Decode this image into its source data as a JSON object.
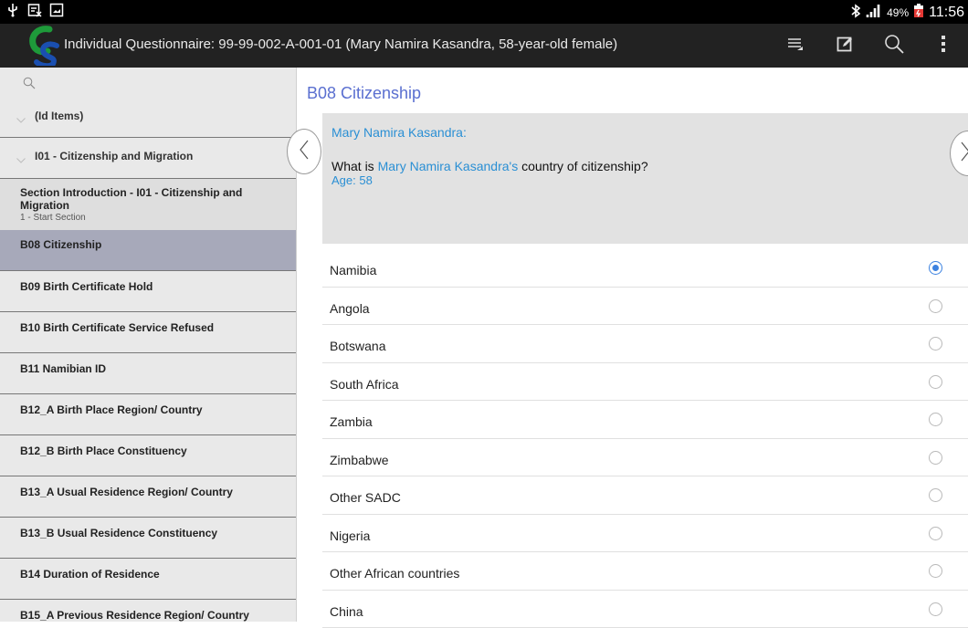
{
  "statusbar": {
    "left_icons": [
      "usb-icon",
      "notification-icon",
      "screenshot-icon"
    ],
    "battery_percent": "49%",
    "time": "11:56"
  },
  "actionbar": {
    "title": "Individual Questionnaire: 99-99-002-A-001-01 (Mary Namira Kasandra, 58-year-old female)",
    "actions": [
      "list-icon",
      "edit-icon",
      "search-icon",
      "overflow-menu-icon"
    ],
    "colors": {
      "background": "#222222",
      "logo_green": "#1e9a3a",
      "logo_blue": "#1a4fb0"
    }
  },
  "sidebar": {
    "items": [
      {
        "label": "(Id Items)",
        "type": "group"
      },
      {
        "label": "I01 - Citizenship and Migration",
        "type": "group"
      },
      {
        "label": "Section Introduction - I01 - Citizenship and Migration",
        "sub": "1 - Start Section",
        "type": "intro"
      },
      {
        "label": "B08 Citizenship",
        "type": "active"
      },
      {
        "label": "B09 Birth Certificate Hold",
        "type": "item"
      },
      {
        "label": "B10 Birth Certificate Service Refused",
        "type": "item"
      },
      {
        "label": "B11 Namibian ID",
        "type": "item"
      },
      {
        "label": "B12_A Birth Place Region/ Country",
        "type": "item"
      },
      {
        "label": "B12_B Birth Place Constituency",
        "type": "item"
      },
      {
        "label": "B13_A Usual Residence Region/ Country",
        "type": "item"
      },
      {
        "label": "B13_B Usual Residence Constituency",
        "type": "item"
      },
      {
        "label": "B14 Duration of Residence",
        "type": "item"
      },
      {
        "label": "B15_A Previous Residence Region/ Country",
        "type": "item"
      }
    ]
  },
  "question": {
    "title": "B08 Citizenship",
    "respondent": "Mary Namira Kasandra:",
    "text_before": "What is ",
    "text_name": "Mary Namira Kasandra's",
    "text_after": " country of citizenship?",
    "age": "Age: 58"
  },
  "options": [
    {
      "label": "Namibia",
      "selected": true
    },
    {
      "label": "Angola",
      "selected": false
    },
    {
      "label": "Botswana",
      "selected": false
    },
    {
      "label": "South Africa",
      "selected": false
    },
    {
      "label": "Zambia",
      "selected": false
    },
    {
      "label": "Zimbabwe",
      "selected": false
    },
    {
      "label": "Other SADC",
      "selected": false
    },
    {
      "label": "Nigeria",
      "selected": false
    },
    {
      "label": "Other African countries",
      "selected": false
    },
    {
      "label": "China",
      "selected": false
    }
  ]
}
